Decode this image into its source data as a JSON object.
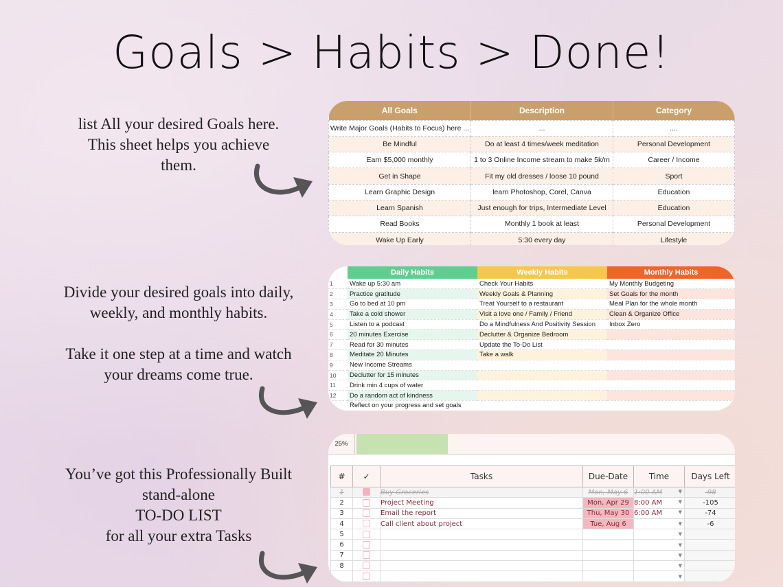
{
  "title": "Goals > Habits > Done!",
  "sections": {
    "goals_text": "list All your desired Goals here.\nThis sheet helps you achieve\nthem.",
    "habits_text": "Divide your desired goals into daily,\nweekly, and monthly habits.\n\nTake it one step at a time and watch\nyour dreams come true.",
    "todo_text": "You’ve got this Professionally Built\nstand-alone\nTO-DO LIST\nfor all your extra Tasks"
  },
  "goals": {
    "headers": [
      "All Goals",
      "Description",
      "Category"
    ],
    "rows": [
      [
        "Write Major Goals (Habits to Focus) here ...",
        "...",
        "...."
      ],
      [
        "Be Mindful",
        "Do at least 4 times/week meditation",
        "Personal Development"
      ],
      [
        "Earn $5,000 monthly",
        "1 to 3 Online Income stream to make 5k/m",
        "Career / Income"
      ],
      [
        "Get in Shape",
        "Fit my old dresses / loose 10 pound",
        "Sport"
      ],
      [
        "Learn Graphic Design",
        "learn Photoshop,  Corel, Canva",
        "Education"
      ],
      [
        "Learn Spanish",
        "Just enough for trips, Intermediate Level",
        "Education"
      ],
      [
        "Read Books",
        "Monthly 1 book at least",
        "Personal Development"
      ],
      [
        "Wake Up Early",
        "5:30 every day",
        "Lifestyle"
      ]
    ],
    "header_color": "#c9a06b"
  },
  "habits": {
    "headers": [
      "Daily Habits",
      "Weekly Habits",
      "Monthly Habits"
    ],
    "colors": [
      "#5ecf90",
      "#f5c84a",
      "#f0642a"
    ],
    "tints": [
      "#e5f6ee",
      "#fdf3dc",
      "#fde4dc"
    ],
    "rows": [
      [
        "1",
        "Wake up 5:30 am",
        "Check Your Habits",
        "My Monthly Budgeting"
      ],
      [
        "2",
        "Practice gratitude",
        "Weekly Goals & Planning",
        "Set Goals for the month"
      ],
      [
        "3",
        "Go to bed at 10 pm",
        "Treat Yourself to a restaurant",
        "Meal Plan for the whole month"
      ],
      [
        "4",
        "Take a cold shower",
        "Visit a love one / Family / Friend",
        "Clean & Organize Office"
      ],
      [
        "5",
        "Listen to a podcast",
        "Do a Mindfulness And Positivity Session",
        "Inbox Zero"
      ],
      [
        "6",
        "20 minutes Exercise",
        "Declutter & Organize Bedroom",
        ""
      ],
      [
        "7",
        "Read for 30 minutes",
        "Update the To-Do List",
        ""
      ],
      [
        "8",
        "Meditate 20 Minutes",
        "Take a walk",
        ""
      ],
      [
        "9",
        "New Income Streams",
        "",
        ""
      ],
      [
        "10",
        "Declutter for 15 minutes",
        "",
        ""
      ],
      [
        "11",
        "Drink min 4 cups of water",
        "",
        ""
      ],
      [
        "12",
        "Do a random act of kindness",
        "",
        ""
      ],
      [
        "",
        "Reflect on your progress and set goals",
        "",
        ""
      ]
    ]
  },
  "todo": {
    "progress_label": "25%",
    "progress": 0.25,
    "headers": [
      "#",
      "✓",
      "Tasks",
      "Due-Date",
      "Time",
      "Days Left"
    ],
    "rows": [
      {
        "n": "1",
        "checked": true,
        "task": "Buy Groceries",
        "due": "Mon, May 6",
        "time": "1:00 AM",
        "days": "-98"
      },
      {
        "n": "2",
        "checked": false,
        "task": "Project Meeting",
        "due": "Mon, Apr 29",
        "time": "8:00 AM",
        "days": "-105"
      },
      {
        "n": "3",
        "checked": false,
        "task": "Email the report",
        "due": "Thu, May 30",
        "time": "6:00 AM",
        "days": "-74"
      },
      {
        "n": "4",
        "checked": false,
        "task": "Call client about project",
        "due": "Tue, Aug 6",
        "time": "",
        "days": "-6"
      },
      {
        "n": "5",
        "checked": false,
        "task": "",
        "due": "",
        "time": "",
        "days": ""
      },
      {
        "n": "6",
        "checked": false,
        "task": "",
        "due": "",
        "time": "",
        "days": ""
      },
      {
        "n": "7",
        "checked": false,
        "task": "",
        "due": "",
        "time": "",
        "days": ""
      },
      {
        "n": "8",
        "checked": false,
        "task": "",
        "due": "",
        "time": "",
        "days": ""
      },
      {
        "n": "",
        "checked": false,
        "task": "",
        "due": "",
        "time": "",
        "days": ""
      }
    ]
  }
}
